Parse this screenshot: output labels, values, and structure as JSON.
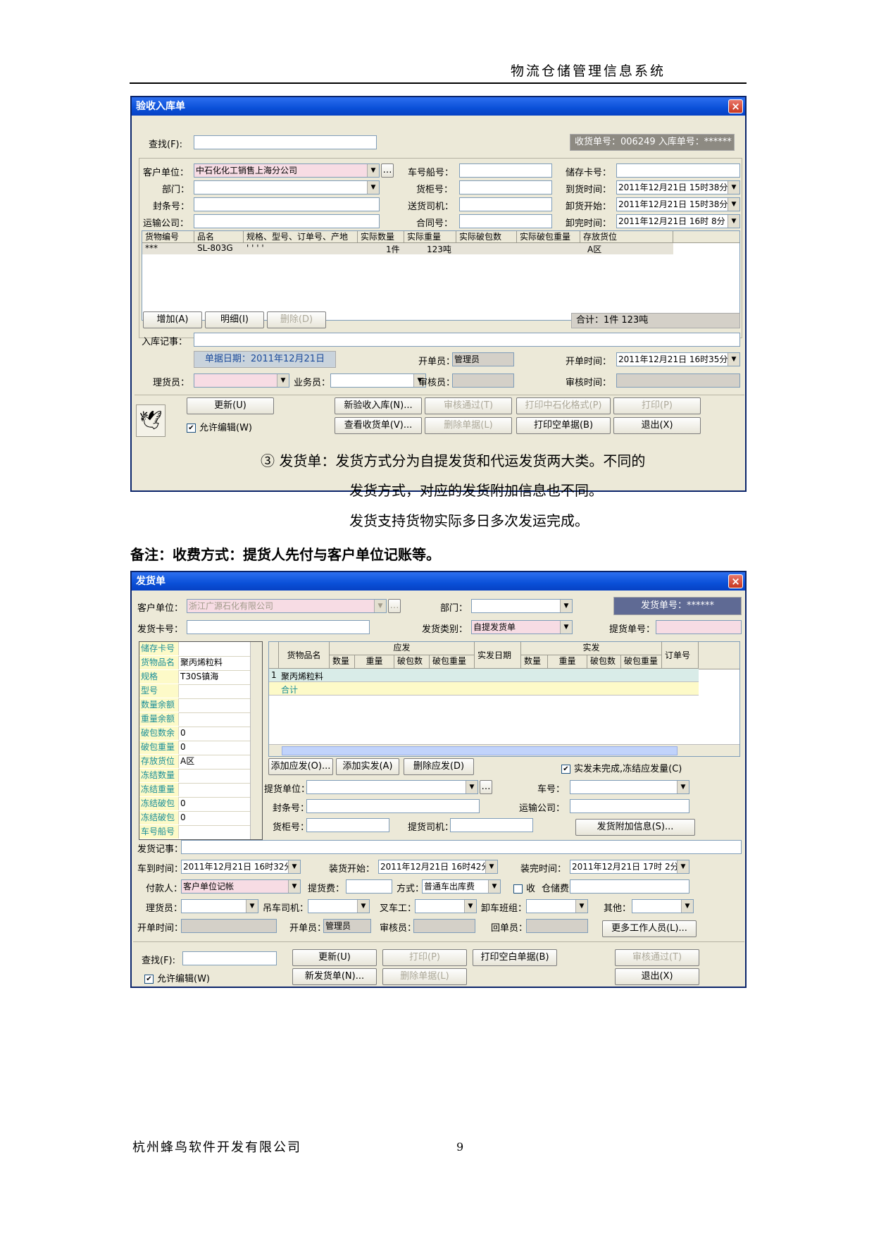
{
  "header": {
    "doc_title": "物流仓储管理信息系统"
  },
  "receipt": {
    "title": "验收入库单",
    "close": "×",
    "find_label": "查找(F):",
    "numbers": "收货单号：006249    入库单号：******",
    "customer_label": "客户单位：",
    "customer_value": "中石化化工销售上海分公司",
    "dept_label": "部门：",
    "seal_label": "封条号：",
    "transport_label": "运输公司：",
    "vehicle_label": "车号船号：",
    "container_label": "货柜号：",
    "driver_label": "送货司机：",
    "contract_label": "合同号：",
    "storage_card_label": "储存卡号：",
    "arrive_label": "到货时间：",
    "arrive_value": "2011年12月21日   15时38分",
    "unload_start_label": "卸货开始：",
    "unload_start_value": "2011年12月21日   15时38分",
    "unload_end_label": "卸完时间：",
    "unload_end_value": "2011年12月21日   16时 8分",
    "columns": [
      "货物编号",
      "品名",
      "规格、型号、订单号、产地",
      "实际数量",
      "实际重量",
      "实际破包数",
      "实际破包重量",
      "存放货位"
    ],
    "row": [
      "***",
      "SL-803G",
      "' ' ' '",
      "1件",
      "123吨",
      "",
      "",
      "A区"
    ],
    "add_btn": "增加(A)",
    "detail_btn": "明细(I)",
    "delete_btn": "删除(D)",
    "total": "合计：1件    123吨",
    "note_label": "入库记事：",
    "doc_date": "单据日期：2011年12月21日",
    "opener_label": "开单员：",
    "opener_value": "管理员",
    "open_time_label": "开单时间：",
    "open_time_value": "2011年12月21日   16时35分",
    "clerk_label": "理货员：",
    "sales_label": "业务员：",
    "auditor_label": "审核员：",
    "audit_time_label": "审核时间：",
    "update_btn": "更新(U)",
    "new_btn": "新验收入库(N)...",
    "approve_btn": "审核通过(T)",
    "print_sinopec_btn": "打印中石化格式(P)",
    "print_btn": "打印(P)",
    "allow_edit": "允许编辑(W)",
    "view_btn": "查看收货单(V)...",
    "del_doc_btn": "删除单据(L)",
    "print_empty_btn": "打印空单据(B)",
    "exit_btn": "退出(X)"
  },
  "paragraph": {
    "line1": "③ 发货单：发货方式分为自提发货和代运发货两大类。不同的",
    "line2": "发货方式，对应的发货附加信息也不同。",
    "line3": "发货支持货物实际多日多次发运完成。"
  },
  "note": "备注：收费方式：提货人先付与客户单位记账等。",
  "ship": {
    "title": "发货单",
    "close": "×",
    "customer_label": "客户单位：",
    "customer_value": "浙江广源石化有限公司",
    "dept_label": "部门：",
    "ship_no": "发货单号：******",
    "card_label": "发货卡号：",
    "type_label": "发货类别：",
    "type_value": "自提发货单",
    "pick_no_label": "提货单号：",
    "left_panel": [
      {
        "k": "储存卡号",
        "v": ""
      },
      {
        "k": "货物品名",
        "v": "聚丙烯粒料"
      },
      {
        "k": "规格",
        "v": "T30S镇海"
      },
      {
        "k": "型号",
        "v": ""
      },
      {
        "k": "数量余额",
        "v": ""
      },
      {
        "k": "重量余额",
        "v": ""
      },
      {
        "k": "破包数余",
        "v": "0"
      },
      {
        "k": "破包重量",
        "v": "0"
      },
      {
        "k": "存放货位",
        "v": "A区"
      },
      {
        "k": "冻结数量",
        "v": ""
      },
      {
        "k": "冻结重量",
        "v": ""
      },
      {
        "k": "冻结破包",
        "v": "0"
      },
      {
        "k": "冻结破包",
        "v": "0"
      },
      {
        "k": "车号船号",
        "v": ""
      }
    ],
    "grid_name": "货物品名",
    "should_group": "应发",
    "actual_group": "实发",
    "actual_date": "实发日期",
    "order_no": "订单号",
    "sub_cols": [
      "数量",
      "重量",
      "破包数",
      "破包重量"
    ],
    "row1_idx": "1",
    "row1_name": "聚丙烯粒料",
    "total_row": "合计",
    "add_should_btn": "添加应发(O)...",
    "add_actual_btn": "添加实发(A)",
    "del_should_btn": "删除应发(D)",
    "freeze_label": "实发未完成,冻结应发量(C)",
    "pick_unit_label": "提货单位：",
    "vehicle_label": "车号：",
    "seal_label": "封条号：",
    "transport_label": "运输公司：",
    "container_label": "货柜号：",
    "pick_driver_label": "提货司机：",
    "extra_btn": "发货附加信息(S)...",
    "note_label": "发货记事：",
    "arrive_label": "车到时间：",
    "arrive_value": "2011年12月21日   16时32分",
    "load_start_label": "装货开始：",
    "load_start_value": "2011年12月21日   16时42分",
    "load_end_label": "装完时间：",
    "load_end_value": "2011年12月21日   17时 2分",
    "payer_label": "付款人：",
    "payer_value": "客户单位记帐",
    "pick_fee_label": "提货费：",
    "method_label": "方式：",
    "method_value": "普通车出库费",
    "receive_label": "收",
    "storage_fee_label": "仓储费：",
    "clerk_label": "理货员：",
    "crane_label": "吊车司机：",
    "forklift_label": "叉车工：",
    "unload_team_label": "卸车班组：",
    "other_label": "其他：",
    "open_time_label": "开单时间：",
    "opener_label": "开单员：",
    "opener_value": "管理员",
    "auditor_label": "审核员：",
    "returner_label": "回单员：",
    "more_staff_btn": "更多工作人员(L)...",
    "find_label": "查找(F):",
    "update_btn": "更新(U)",
    "print_btn": "打印(P)",
    "print_empty_btn": "打印空白单据(B)",
    "approve_btn": "审核通过(T)",
    "allow_edit": "允许编辑(W)",
    "new_btn": "新发货单(N)...",
    "del_doc_btn": "删除单据(L)",
    "exit_btn": "退出(X)"
  },
  "footer": {
    "company": "杭州蜂鸟软件开发有限公司",
    "page": "9"
  }
}
